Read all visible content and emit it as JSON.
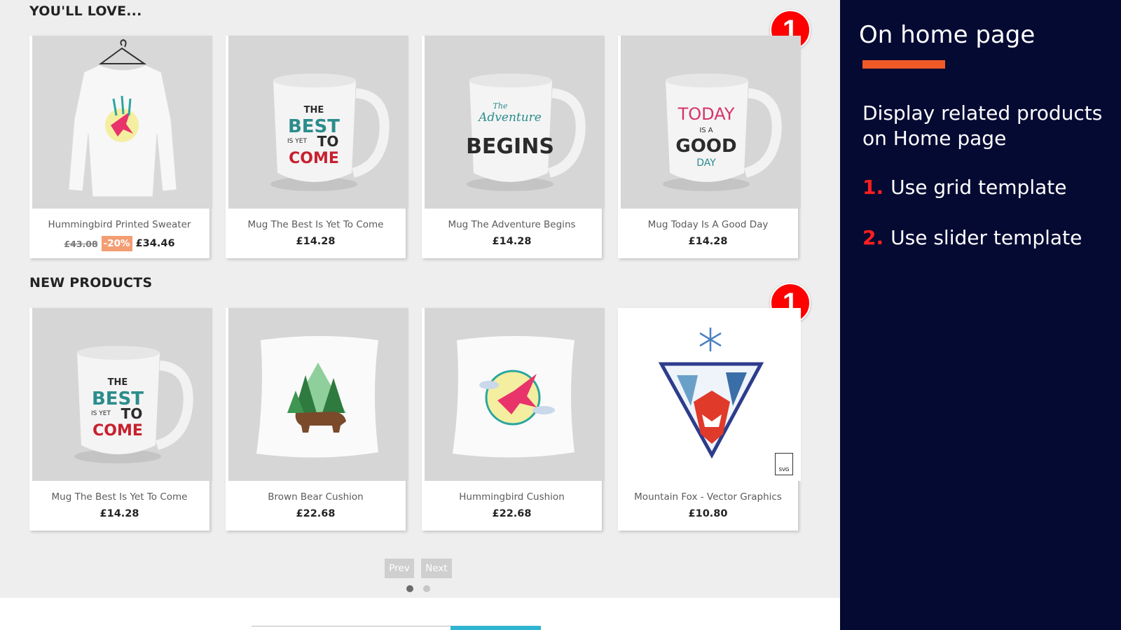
{
  "related_section": {
    "title": "YOU'LL LOVE...",
    "badge": "1",
    "products": [
      {
        "name": "Hummingbird Printed Sweater",
        "old_price": "£43.08",
        "discount": "-20%",
        "price": "£34.46",
        "image": "sweater-image"
      },
      {
        "name": "Mug The Best Is Yet To Come",
        "price": "£14.28",
        "image": "mug-best-image"
      },
      {
        "name": "Mug The Adventure Begins",
        "price": "£14.28",
        "image": "mug-adventure-image"
      },
      {
        "name": "Mug Today Is A Good Day",
        "price": "£14.28",
        "image": "mug-today-image"
      }
    ]
  },
  "new_section": {
    "title": "NEW PRODUCTS",
    "badge": "1",
    "products": [
      {
        "name": "Mug The Best Is Yet To Come",
        "price": "£14.28",
        "image": "mug-best-image"
      },
      {
        "name": "Brown Bear Cushion",
        "price": "£22.68",
        "image": "bear-cushion-image"
      },
      {
        "name": "Hummingbird Cushion",
        "price": "£22.68",
        "image": "hummingbird-cushion-image"
      },
      {
        "name": "Mountain Fox - Vector Graphics",
        "price": "£10.80",
        "image": "fox-vector-image",
        "file_badge": "SVG"
      }
    ]
  },
  "mug_art": {
    "best": [
      "THE",
      "BEST",
      "IS YET",
      "TO",
      "COME"
    ],
    "adventure": [
      "The",
      "Adventure",
      "BEGINS"
    ],
    "today": [
      "TODAY",
      "IS A",
      "GOOD",
      "DAY"
    ]
  },
  "slider": {
    "prev_label": "Prev",
    "next_label": "Next",
    "pages": 2,
    "active_page": 1
  },
  "panel": {
    "title": "On home page",
    "description": "Display related products on Home page",
    "steps": [
      {
        "number": "1.",
        "label": "Use grid template"
      },
      {
        "number": "2.",
        "label": "Use slider template"
      }
    ]
  },
  "colors": {
    "panel_bg": "#050a33",
    "accent_orange": "#f05a28",
    "badge_red": "#ff0000",
    "discount_bg": "#f39d72",
    "newsletter_button": "#2fb5d2"
  }
}
